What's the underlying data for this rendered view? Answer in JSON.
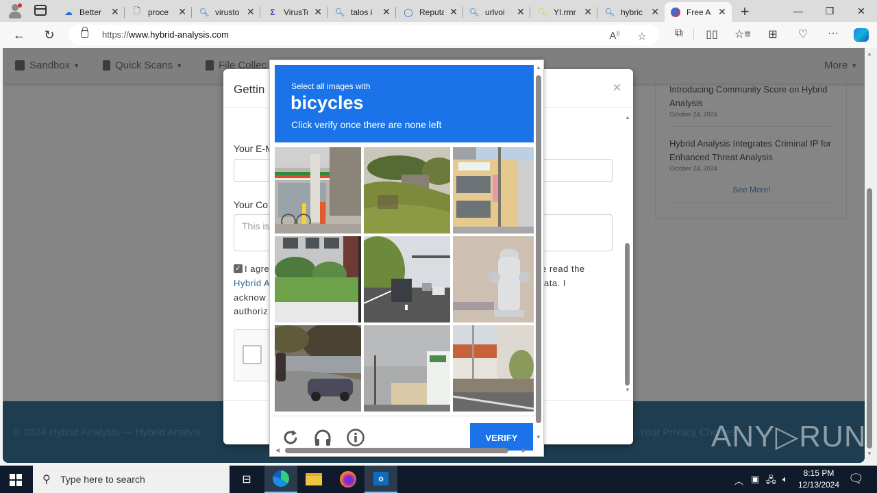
{
  "browser": {
    "tabs": [
      {
        "label": "Better",
        "icon": "onedrive-icon",
        "active": false
      },
      {
        "label": "proce",
        "icon": "document-icon",
        "active": false
      },
      {
        "label": "virusto",
        "icon": "search-icon",
        "active": false
      },
      {
        "label": "VirusTo",
        "icon": "virustotal-icon",
        "active": false
      },
      {
        "label": "talos i",
        "icon": "search-icon",
        "active": false
      },
      {
        "label": "Reputa",
        "icon": "reputation-icon",
        "active": false
      },
      {
        "label": "urlvoi",
        "icon": "search-icon",
        "active": false
      },
      {
        "label": "YI.rmr",
        "icon": "search-icon-yellow",
        "active": false
      },
      {
        "label": "hybric",
        "icon": "search-icon",
        "active": false
      },
      {
        "label": "Free A",
        "icon": "hybrid-analysis-icon",
        "active": true
      }
    ],
    "close_glyph": "✕",
    "new_tab_glyph": "+",
    "window_controls": {
      "minimize": "—",
      "restore": "❐",
      "close": "✕"
    },
    "address": {
      "scheme": "https://",
      "host": "www.hybrid-analysis.com"
    },
    "nav": {
      "back": "←",
      "reload": "↻"
    },
    "toolbar_icons": [
      "read-aloud-icon",
      "favorite-star-icon",
      "extensions-icon",
      "split-screen-icon",
      "favorites-icon",
      "collections-icon",
      "browser-essentials-icon",
      "more-icon",
      "copilot-icon"
    ]
  },
  "page": {
    "nav": {
      "items": [
        {
          "label": "Sandbox"
        },
        {
          "label": "Quick Scans"
        },
        {
          "label": "File Collec"
        }
      ],
      "more_label": "More"
    },
    "news": [
      {
        "title": "Introducing Community Score on Hybrid Analysis",
        "date": "October 24, 2024"
      },
      {
        "title": "Hybrid Analysis Integrates Criminal IP for Enhanced Threat Analysis",
        "date": "October 24, 2024"
      }
    ],
    "see_more": "See More!",
    "footer": {
      "left": "© 2024 Hybrid Analysis — Hybrid Analysi",
      "right": "- Your Privacy Choices"
    }
  },
  "modal": {
    "title": "Gettin",
    "close": "×",
    "email_label": "Your E-M",
    "comment_label": "Your Co",
    "comment_placeholder": "This is",
    "agree_line1_left": "I agre",
    "agree_line1_right": "e read the",
    "agree_link": "Hybrid A",
    "agree_line2_right": "ata. I",
    "agree_line3": "acknow",
    "agree_line4": "authoriz",
    "agree_checked": true
  },
  "captcha": {
    "instruction_small": "Select all images with",
    "target": "bicycles",
    "instruction_sub": "Click verify once there are none left",
    "tiles": [
      {
        "subject": "convenience store with bicycle",
        "selected": false
      },
      {
        "subject": "grassy hillside",
        "selected": false
      },
      {
        "subject": "yellow building storefront",
        "selected": false
      },
      {
        "subject": "garden with iron fence",
        "selected": false
      },
      {
        "subject": "highway with truck",
        "selected": false
      },
      {
        "subject": "fire hydrant on gravel",
        "selected": false
      },
      {
        "subject": "car on curved street",
        "selected": false
      },
      {
        "subject": "overcast street with building",
        "selected": false
      },
      {
        "subject": "street with red-roofed building",
        "selected": false
      }
    ],
    "verify_label": "VERIFY",
    "icons": [
      "reload-icon",
      "audio-headphones-icon",
      "info-icon"
    ]
  },
  "watermark": "ANY▷RUN",
  "taskbar": {
    "search_placeholder": "Type here to search",
    "apps": [
      "task-view-icon",
      "edge-icon",
      "file-explorer-icon",
      "firefox-icon",
      "outlook-icon"
    ],
    "time": "8:15 PM",
    "date": "12/13/2024"
  },
  "colors": {
    "captcha_blue": "#1a73e8",
    "footer_navy": "#1f3d50",
    "link_blue": "#2a6496"
  }
}
